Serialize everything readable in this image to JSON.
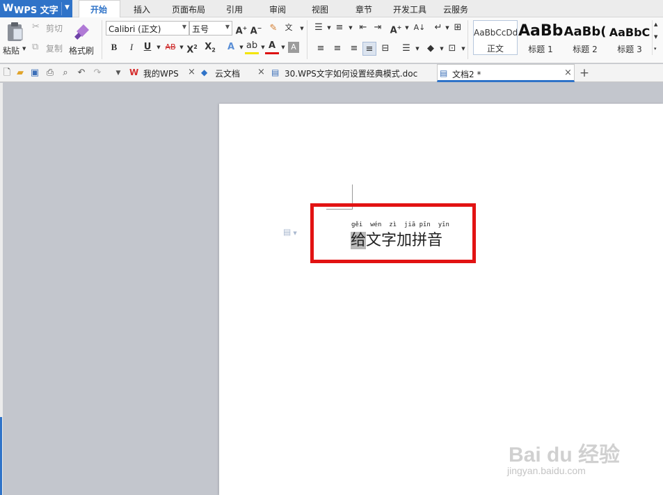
{
  "app": {
    "title": "WPS 文字"
  },
  "menu": {
    "tabs": [
      "开始",
      "插入",
      "页面布局",
      "引用",
      "审阅",
      "视图",
      "章节",
      "开发工具",
      "云服务"
    ]
  },
  "ribbon": {
    "paste_label": "粘贴",
    "cut_label": "剪切",
    "copy_label": "复制",
    "format_painter_label": "格式刷",
    "font_name": "Calibri (正文)",
    "font_size": "五号",
    "styles": [
      {
        "sample": "AaBbCcDd",
        "label": "正文"
      },
      {
        "sample": "AaBb",
        "label": "标题 1"
      },
      {
        "sample": "AaBb(",
        "label": "标题 2"
      },
      {
        "sample": "AaBbC",
        "label": "标题 3"
      }
    ]
  },
  "doc_tabs": [
    {
      "title": "我的WPS"
    },
    {
      "title": "云文档"
    },
    {
      "title": "30.WPS文字如何设置经典模式.doc"
    },
    {
      "title": "文档2 *"
    }
  ],
  "document": {
    "pinyin": [
      "gěi",
      "wén",
      "zì",
      "jiā",
      "pīn",
      "yīn"
    ],
    "first_char": "给",
    "rest_text": "文字加拼音"
  },
  "watermark": {
    "brand": "Bai du 经验",
    "url": "jingyan.baidu.com"
  },
  "colors": {
    "accent": "#2f73c8",
    "highlight_box": "#e21313"
  }
}
